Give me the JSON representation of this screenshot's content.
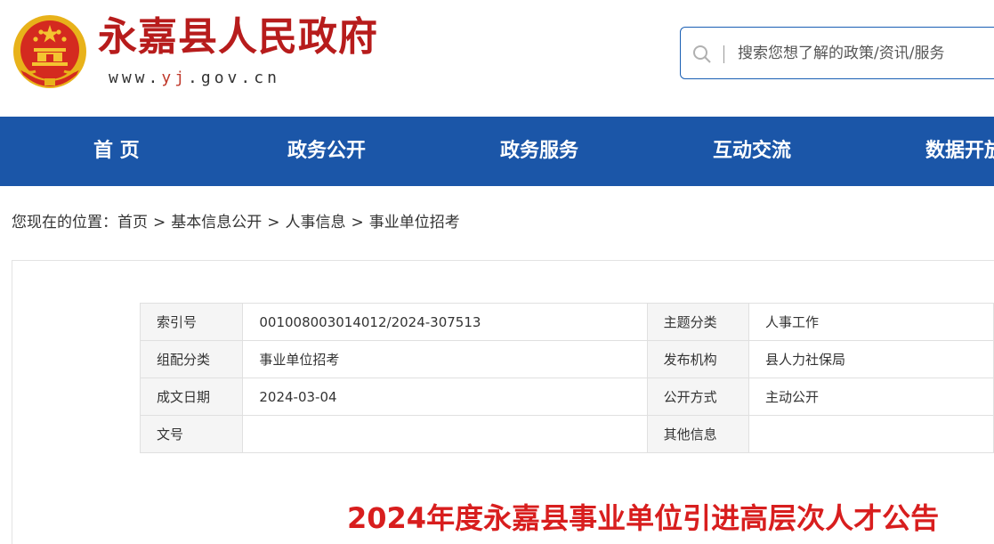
{
  "header": {
    "site_title": "永嘉县人民政府",
    "url_prefix": "www.",
    "url_accent": "yj",
    "url_suffix": ".gov.cn",
    "emblem_icon": "national-emblem-icon"
  },
  "search": {
    "placeholder": "搜索您想了解的政策/资讯/服务",
    "icon": "search-icon"
  },
  "nav": {
    "items": [
      {
        "label": "首 页"
      },
      {
        "label": "政务公开"
      },
      {
        "label": "政务服务"
      },
      {
        "label": "互动交流"
      },
      {
        "label": "数据开放"
      }
    ]
  },
  "breadcrumb": {
    "prefix": "您现在的位置：",
    "items": [
      "首页",
      "基本信息公开",
      "人事信息",
      "事业单位招考"
    ],
    "separator": ">"
  },
  "meta_table": {
    "rows": [
      {
        "label1": "索引号",
        "value1": "001008003014012/2024-307513",
        "label2": "主题分类",
        "value2": "人事工作"
      },
      {
        "label1": "组配分类",
        "value1": "事业单位招考",
        "label2": "发布机构",
        "value2": "县人力社保局"
      },
      {
        "label1": "成文日期",
        "value1": "2024-03-04",
        "label2": "公开方式",
        "value2": "主动公开"
      },
      {
        "label1": "文号",
        "value1": "",
        "label2": "其他信息",
        "value2": ""
      }
    ]
  },
  "article": {
    "title": "2024年度永嘉县事业单位引进高层次人才公告"
  },
  "colors": {
    "nav_bg": "#1b56a8",
    "title_red": "#d81e1e",
    "site_title_red": "#b71c1c"
  }
}
